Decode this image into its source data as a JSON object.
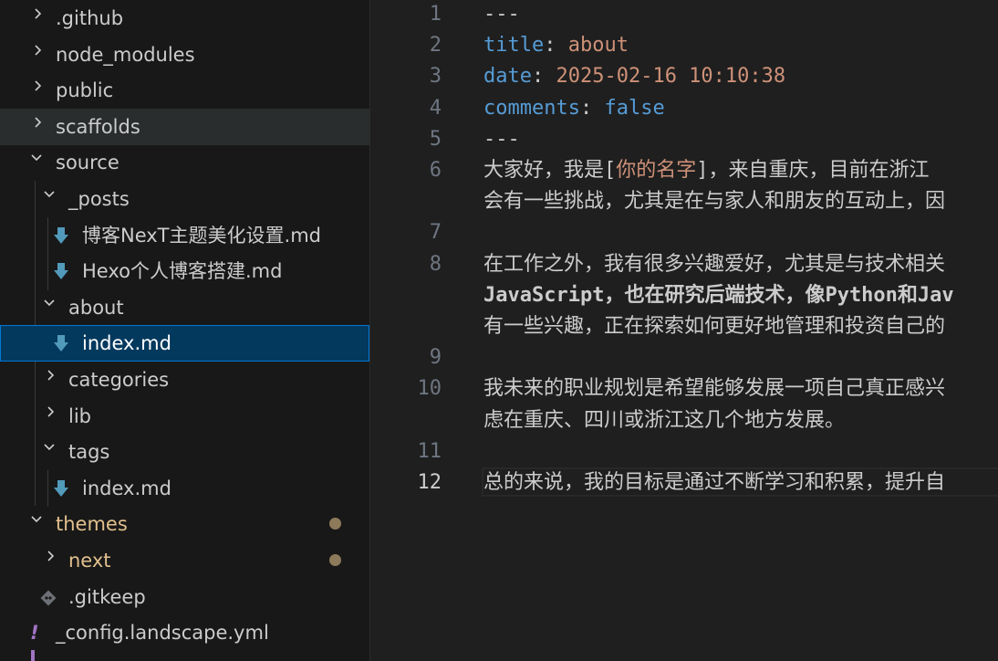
{
  "explorer": {
    "items": [
      {
        "label": ".github"
      },
      {
        "label": "node_modules"
      },
      {
        "label": "public"
      },
      {
        "label": "scaffolds"
      },
      {
        "label": "source"
      },
      {
        "label": "_posts"
      },
      {
        "label": "博客NexT主题美化设置.md"
      },
      {
        "label": "Hexo个人博客搭建.md"
      },
      {
        "label": "about"
      },
      {
        "label": "index.md"
      },
      {
        "label": "categories"
      },
      {
        "label": "lib"
      },
      {
        "label": "tags"
      },
      {
        "label": "index.md"
      },
      {
        "label": "themes"
      },
      {
        "label": "next"
      },
      {
        "label": ".gitkeep"
      },
      {
        "label": "_config.landscape.yml"
      }
    ],
    "yaml_icon_glyph": "!"
  },
  "editor": {
    "line_numbers": [
      "1",
      "2",
      "3",
      "4",
      "5",
      "6",
      "7",
      "8",
      "9",
      "10",
      "11",
      "12"
    ],
    "current_line": "12",
    "front_matter": {
      "delimiter": "---",
      "title_key": "title",
      "title_value": "about",
      "date_key": "date",
      "date_value": "2025-02-16 10:10:38",
      "comments_key": "comments",
      "comments_value": "false",
      "colon": ": "
    },
    "line6_a": "大家好，我是[",
    "line6_name": "你的名字",
    "line6_b": "]，来自重庆，目前在浙江",
    "line6_wrap": "会有一些挑战，尤其是在与家人和朋友的互动上，因",
    "line8_1": "在工作之外，我有很多兴趣爱好，尤其是与技术相关",
    "line8_2": "JavaScript，也在研究后端技术，像Python和Jav",
    "line8_3": "有一些兴趣，正在探索如何更好地管理和投资自己的",
    "line10_1": "我未来的职业规划是希望能够发展一项自己真正感兴",
    "line10_2": "虑在重庆、四川或浙江这几个地方发展。",
    "line12": "总的来说，我的目标是通过不断学习和积累，提升自"
  },
  "colors": {
    "key": "#569cd6",
    "string": "#ce9178",
    "selection": "#04395e",
    "modified": "#e2c08d"
  }
}
